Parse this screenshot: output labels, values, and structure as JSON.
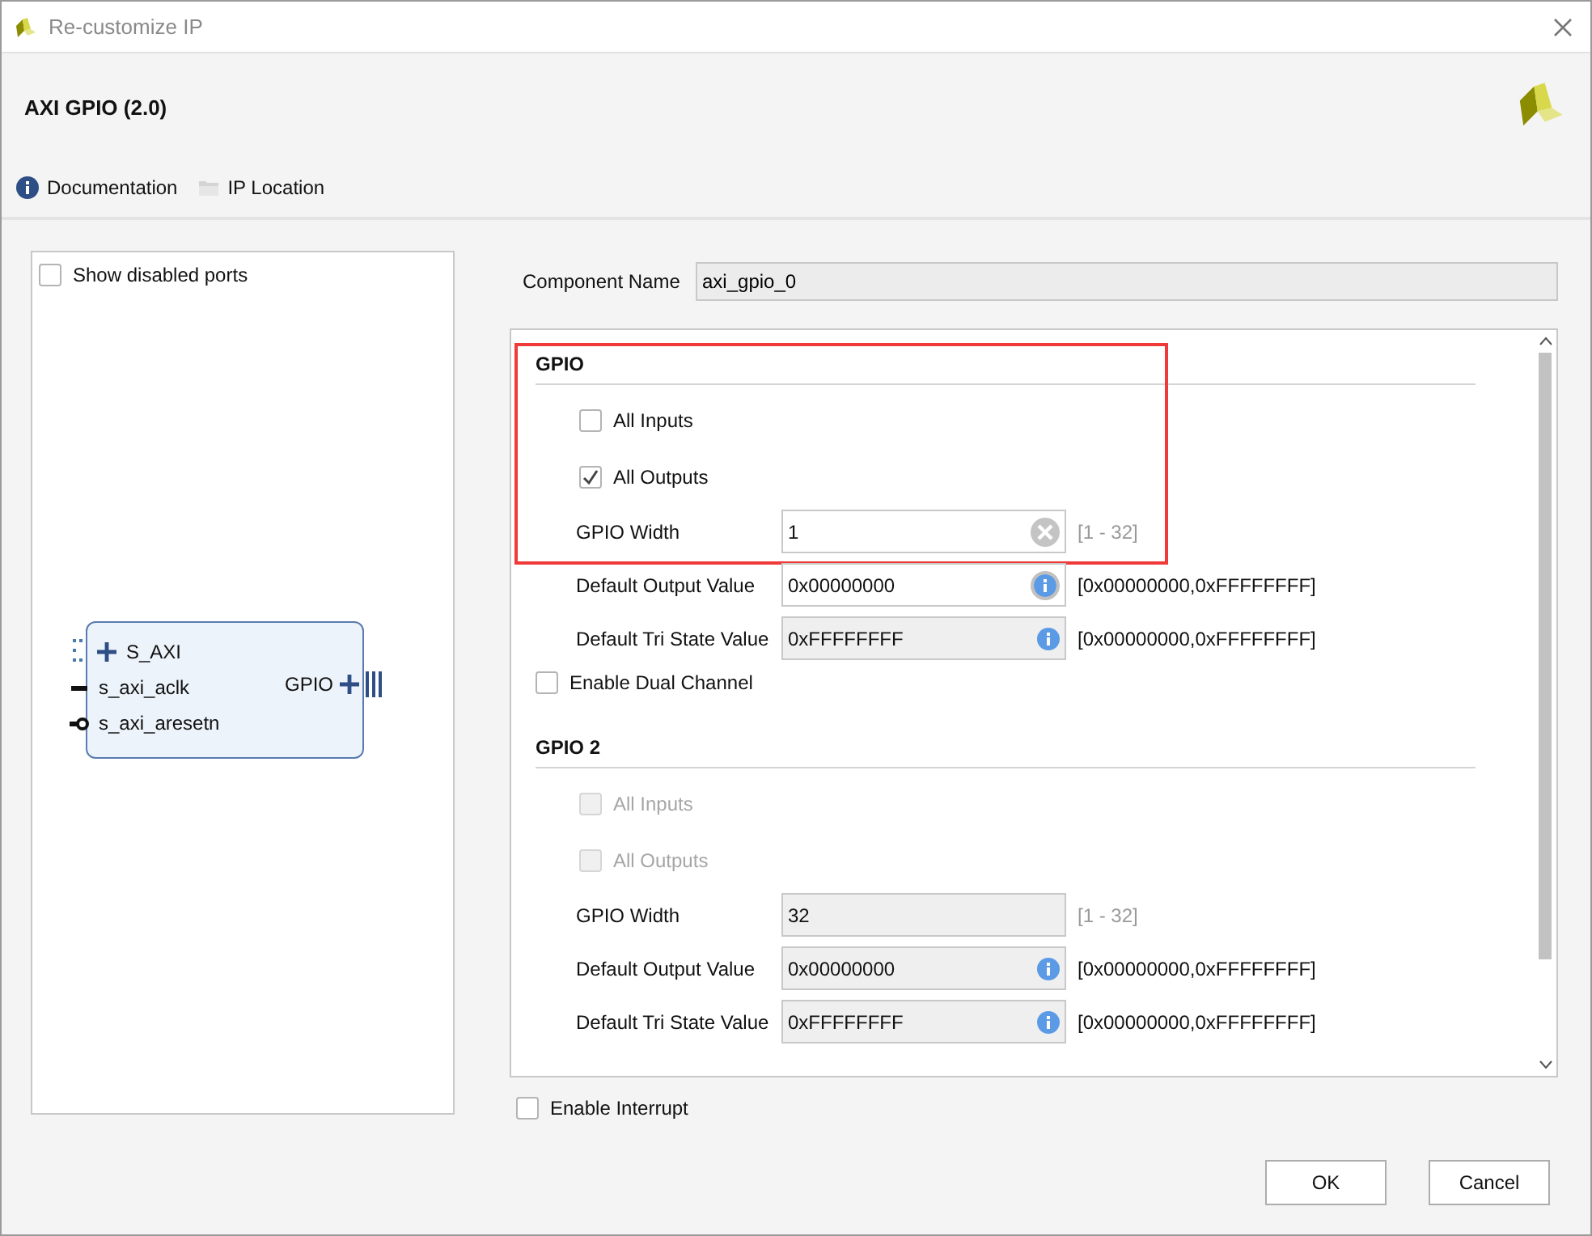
{
  "window": {
    "title": "Re-customize IP"
  },
  "header": {
    "title": "AXI GPIO (2.0)"
  },
  "toolbar": [
    {
      "kind": "info",
      "label": "Documentation"
    },
    {
      "kind": "folder",
      "label": "IP Location"
    }
  ],
  "preview": {
    "show_disabled_ports": {
      "label": "Show disabled ports",
      "checked": false
    },
    "left_ports": [
      {
        "kind": "bus",
        "name": "S_AXI"
      },
      {
        "kind": "clock",
        "name": "s_axi_aclk"
      },
      {
        "kind": "reset",
        "name": "s_axi_aresetn"
      }
    ],
    "right_ports": [
      {
        "kind": "bus",
        "name": "GPIO"
      }
    ]
  },
  "component_name": {
    "label": "Component Name",
    "value": "axi_gpio_0"
  },
  "panel": [
    {
      "kind": "section",
      "title": "GPIO",
      "highlighted": true,
      "rows": [
        {
          "kind": "checkbox",
          "label": "All Inputs",
          "checked": false,
          "disabled": false
        },
        {
          "kind": "checkbox",
          "label": "All Outputs",
          "checked": true,
          "disabled": false
        },
        {
          "kind": "clearfield",
          "label": "GPIO Width",
          "value": "1",
          "editable": true,
          "range": "[1 - 32]",
          "range_dimmed": true
        }
      ]
    },
    {
      "kind": "group",
      "rows": [
        {
          "kind": "infofield",
          "label": "Default Output Value",
          "value": "0x00000000",
          "editable": true,
          "range": "[0x00000000,0xFFFFFFFF]",
          "range_dimmed": false
        },
        {
          "kind": "infofield",
          "label": "Default Tri State Value",
          "value": "0xFFFFFFFF",
          "editable": false,
          "range": "[0x00000000,0xFFFFFFFF]",
          "range_dimmed": false
        }
      ]
    },
    {
      "kind": "checkbox",
      "label": "Enable Dual Channel",
      "checked": false,
      "disabled": false
    },
    {
      "kind": "section",
      "title": "GPIO 2",
      "highlighted": false,
      "rows": [
        {
          "kind": "checkbox",
          "label": "All Inputs",
          "checked": false,
          "disabled": true
        },
        {
          "kind": "checkbox",
          "label": "All Outputs",
          "checked": false,
          "disabled": true
        },
        {
          "kind": "field",
          "label": "GPIO Width",
          "value": "32",
          "editable": false,
          "range": "[1 - 32]",
          "range_dimmed": true
        },
        {
          "kind": "infofield",
          "label": "Default Output Value",
          "value": "0x00000000",
          "editable": false,
          "range": "[0x00000000,0xFFFFFFFF]",
          "range_dimmed": false
        },
        {
          "kind": "infofield",
          "label": "Default Tri State Value",
          "value": "0xFFFFFFFF",
          "editable": false,
          "range": "[0x00000000,0xFFFFFFFF]",
          "range_dimmed": false
        }
      ]
    }
  ],
  "enable_interrupt": {
    "label": "Enable Interrupt",
    "checked": false
  },
  "buttons": [
    {
      "label": "OK"
    },
    {
      "label": "Cancel"
    }
  ]
}
